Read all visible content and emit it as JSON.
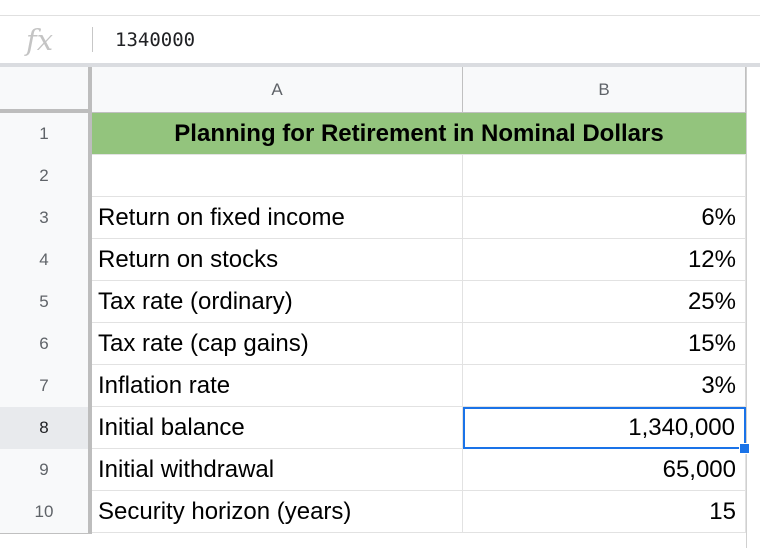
{
  "formula_bar": {
    "fx_label": "fx",
    "value": "1340000"
  },
  "columns": [
    "A",
    "B"
  ],
  "title": "Planning for Retirement in Nominal Dollars",
  "rows": [
    {
      "num": "1",
      "a": "",
      "b": ""
    },
    {
      "num": "2",
      "a": "",
      "b": ""
    },
    {
      "num": "3",
      "a": "Return on fixed income",
      "b": "6%"
    },
    {
      "num": "4",
      "a": "Return on stocks",
      "b": "12%"
    },
    {
      "num": "5",
      "a": "Tax rate (ordinary)",
      "b": "25%"
    },
    {
      "num": "6",
      "a": "Tax rate (cap gains)",
      "b": "15%"
    },
    {
      "num": "7",
      "a": "Inflation rate",
      "b": "3%"
    },
    {
      "num": "8",
      "a": "Initial balance",
      "b": "1,340,000"
    },
    {
      "num": "9",
      "a": "Initial withdrawal",
      "b": "65,000"
    },
    {
      "num": "10",
      "a": "Security horizon (years)",
      "b": "15"
    }
  ],
  "selected_cell": "B8",
  "colors": {
    "title_fill": "#93c47d",
    "selection": "#1a73e8"
  }
}
